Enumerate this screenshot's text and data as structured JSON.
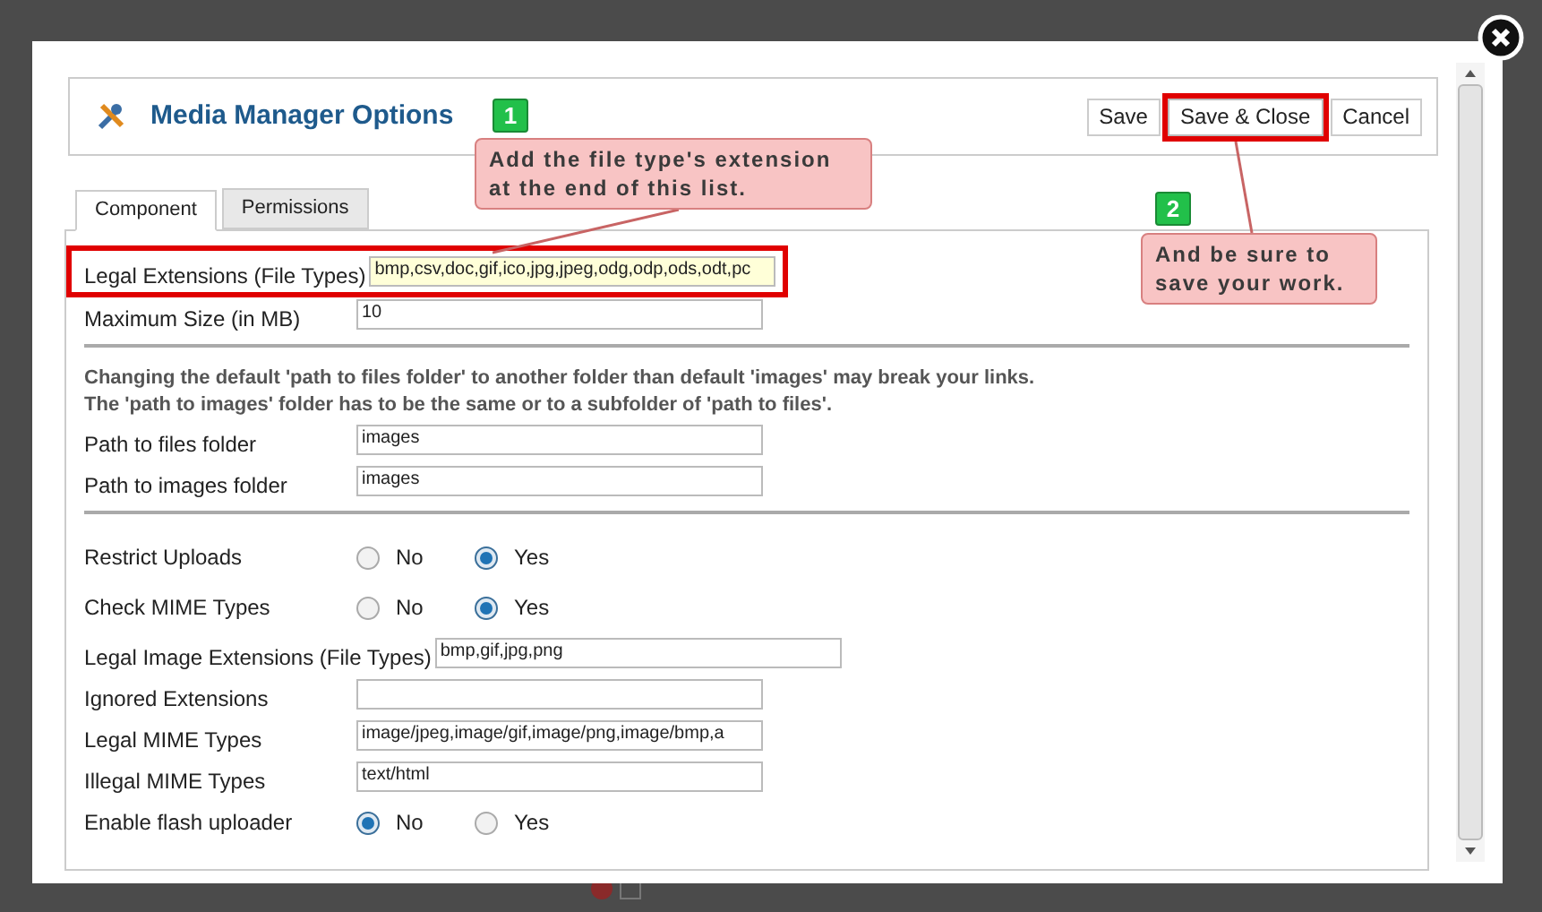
{
  "title": "Media Manager Options",
  "toolbar": [
    {
      "label": "Save",
      "highlighted": false
    },
    {
      "label": "Save & Close",
      "highlighted": true
    },
    {
      "label": "Cancel",
      "highlighted": false
    }
  ],
  "tabs": [
    {
      "label": "Component",
      "selected": true
    },
    {
      "label": "Permissions",
      "selected": false
    }
  ],
  "groups": [
    {
      "fields": [
        {
          "kind": "text",
          "label": "Legal Extensions (File Types)",
          "value": "bmp,csv,doc,gif,ico,jpg,jpeg,odg,odp,ods,odt,pc",
          "highlighted": true
        },
        {
          "kind": "text",
          "label": "Maximum Size (in MB)",
          "value": "10",
          "highlighted": false
        }
      ]
    },
    {
      "notes": [
        "Changing the default 'path to files folder' to another folder than default 'images' may break your links.",
        "The 'path to images' folder has to be the same or to a subfolder of 'path to files'."
      ],
      "fields": [
        {
          "kind": "text",
          "label": "Path to files folder",
          "value": "images",
          "highlighted": false
        },
        {
          "kind": "text",
          "label": "Path to images folder",
          "value": "images",
          "highlighted": false
        }
      ]
    },
    {
      "fields": [
        {
          "kind": "radio",
          "label": "Restrict Uploads",
          "options": [
            {
              "label": "No",
              "selected": false
            },
            {
              "label": "Yes",
              "selected": true
            }
          ]
        },
        {
          "kind": "radio",
          "label": "Check MIME Types",
          "options": [
            {
              "label": "No",
              "selected": false
            },
            {
              "label": "Yes",
              "selected": true
            }
          ]
        },
        {
          "kind": "text",
          "label": "Legal Image Extensions (File Types)",
          "value": "bmp,gif,jpg,png",
          "highlighted": false
        },
        {
          "kind": "text",
          "label": "Ignored Extensions",
          "highlighted": false
        },
        {
          "kind": "text",
          "label": "Legal MIME Types",
          "value": "image/jpeg,image/gif,image/png,image/bmp,a",
          "highlighted": false
        },
        {
          "kind": "text",
          "label": "Illegal MIME Types",
          "value": "text/html",
          "highlighted": false
        },
        {
          "kind": "radio",
          "label": "Enable flash uploader",
          "options": [
            {
              "label": "No",
              "selected": true
            },
            {
              "label": "Yes",
              "selected": false
            }
          ]
        }
      ]
    }
  ],
  "background": {
    "checkbox": {
      "checked": false
    }
  },
  "callouts": [
    {
      "number": "1",
      "text": "Add the file type's extension at the end of this list."
    },
    {
      "number": "2",
      "text": "And be sure to save your work."
    }
  ]
}
